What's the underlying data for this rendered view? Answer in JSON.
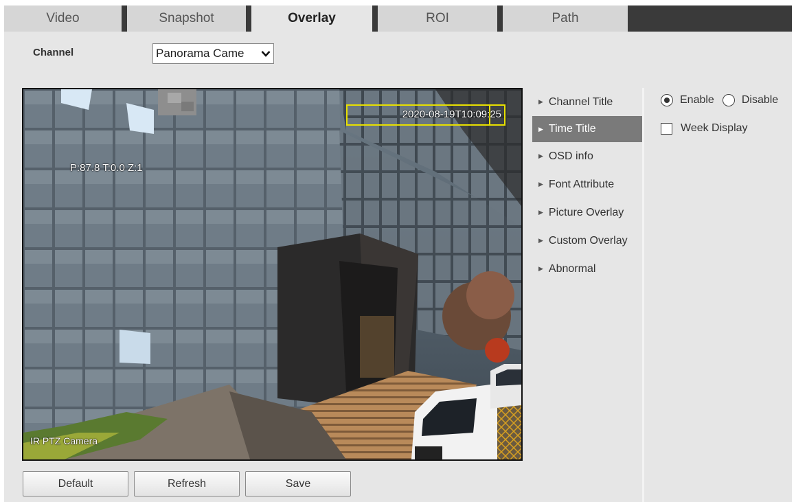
{
  "tabs": [
    {
      "label": "Video"
    },
    {
      "label": "Snapshot"
    },
    {
      "label": "Overlay"
    },
    {
      "label": "ROI"
    },
    {
      "label": "Path"
    }
  ],
  "active_tab": "Overlay",
  "channel": {
    "label": "Channel",
    "selected": "Panorama Came"
  },
  "video_osd": {
    "ptz": "P:87.8 T:0.0 Z:1",
    "time": "2020-08-19T10:09:25",
    "camera_name": "IR PTZ Camera"
  },
  "menu": {
    "items": [
      {
        "label": "Channel Title"
      },
      {
        "label": "Time Title"
      },
      {
        "label": "OSD info"
      },
      {
        "label": "Font Attribute"
      },
      {
        "label": "Picture Overlay"
      },
      {
        "label": "Custom Overlay"
      },
      {
        "label": "Abnormal"
      }
    ],
    "active": "Time Title"
  },
  "settings": {
    "enable_label": "Enable",
    "disable_label": "Disable",
    "enabled": true,
    "week_display_label": "Week Display",
    "week_display_checked": false
  },
  "buttons": {
    "default_label": "Default",
    "refresh_label": "Refresh",
    "save_label": "Save"
  },
  "colors": {
    "tab_bar": "#3a3a3a",
    "panel": "#e6e6e6",
    "menu_active": "#7a7a7a",
    "time_box": "#e8e000"
  },
  "icons": {
    "menu_arrow": "triangle-right-icon",
    "select_chevron": "chevron-down-icon"
  }
}
